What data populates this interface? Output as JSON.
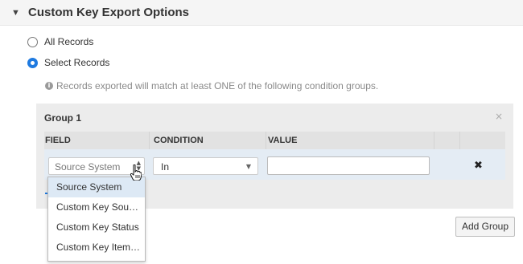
{
  "section": {
    "collapse_glyph": "▼",
    "title": "Custom Key Export Options"
  },
  "radios": {
    "all_records": {
      "label": "All Records",
      "checked": false
    },
    "select_records": {
      "label": "Select Records",
      "checked": true
    }
  },
  "info": {
    "icon": "info-icon",
    "text": "Records exported will match at least ONE of the following condition groups."
  },
  "group": {
    "title": "Group 1",
    "close_glyph": "×",
    "columns": [
      "FIELD",
      "CONDITION",
      "VALUE"
    ],
    "row": {
      "field_placeholder": "Source System",
      "condition_value": "In",
      "value_input": "",
      "delete_glyph": "✖"
    }
  },
  "dropdown": {
    "options": [
      "Source System",
      "Custom Key Sou…",
      "Custom Key Status",
      "Custom Key Item…"
    ],
    "highlighted_index": 0
  },
  "actions": {
    "add_group_label": "Add Group"
  },
  "colors": {
    "accent": "#1f7ae0",
    "group_bg": "#ececec",
    "row_bg": "#e4ecf4",
    "highlight": "#dde9f5"
  }
}
